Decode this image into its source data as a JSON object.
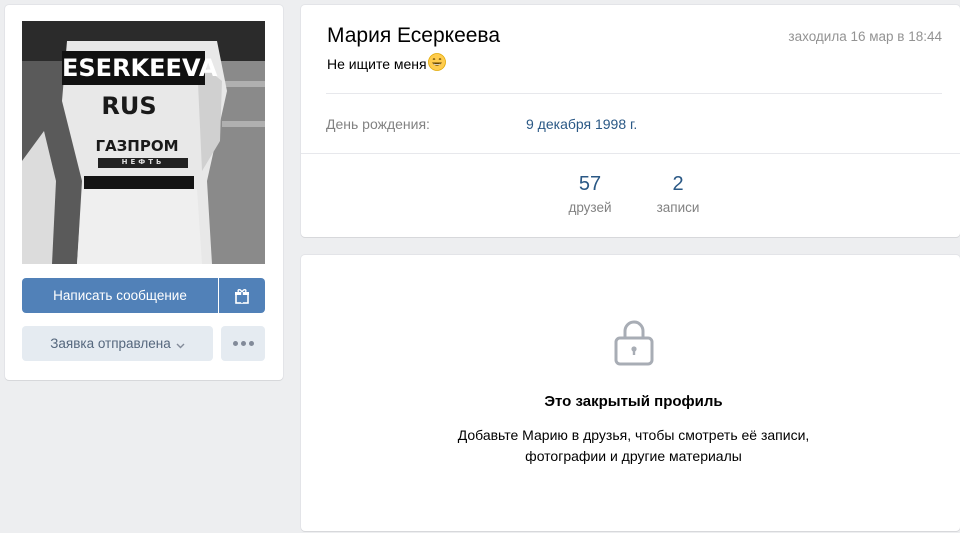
{
  "profile": {
    "name": "Мария Есеркеева",
    "last_seen": "заходила 16 мар в 18:44",
    "status": "Не ищите меня",
    "status_emoji": "smile-emoji",
    "avatar": {
      "name_patch": "ESERKEEVA",
      "country": "RUS",
      "sponsor": "ГАЗПРОМ",
      "sponsor_sub": "НЕФТЬ"
    }
  },
  "details": {
    "birthday_label": "День рождения:",
    "birthday_value": "9 декабря 1998 г."
  },
  "counters": [
    {
      "value": "57",
      "label": "друзей"
    },
    {
      "value": "2",
      "label": "записи"
    }
  ],
  "actions": {
    "message_button": "Написать сообщение",
    "gift_icon": "gift-icon",
    "request_button": "Заявка отправлена",
    "more_icon": "more-dots-icon"
  },
  "closed_profile": {
    "icon": "lock-icon",
    "title": "Это закрытый профиль",
    "description_line1": "Добавьте Марию в друзья, чтобы смотреть её записи,",
    "description_line2": "фотографии и другие материалы"
  },
  "colors": {
    "background": "#edeef0",
    "accent": "#5181b8",
    "link": "#2a5885",
    "secondary_button": "#e5ebf1"
  }
}
